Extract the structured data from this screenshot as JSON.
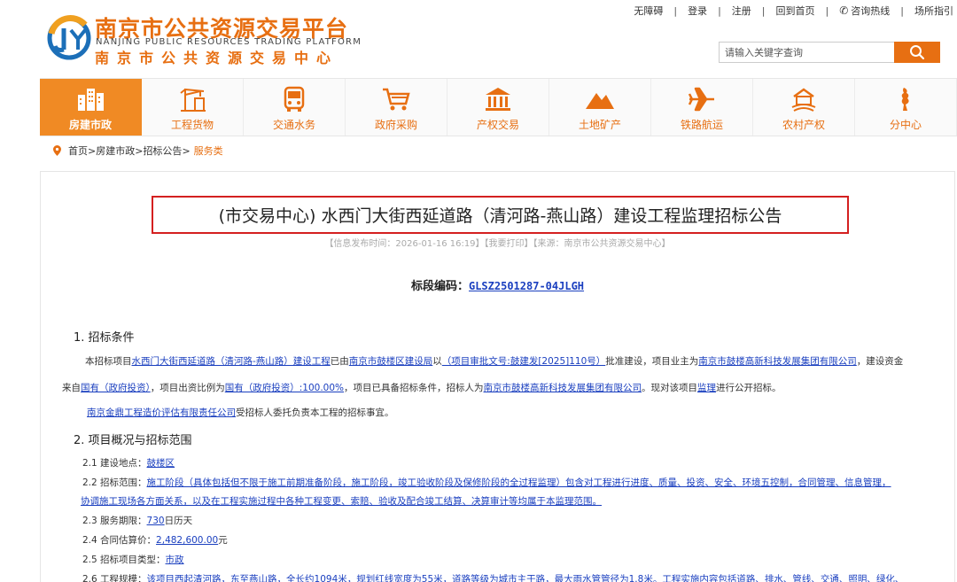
{
  "header": {
    "brand_cn": "南京市公共资源交易平台",
    "brand_en": "NANJING PUBLIC RESOURCES TRADING PLATFORM",
    "brand_center": "南京市公共资源交易中心",
    "links": [
      "无障碍",
      "登录",
      "注册",
      "回到首页",
      "咨询热线",
      "场所指引"
    ],
    "search_placeholder": "请输入关键字查询",
    "accent": "#e76f12"
  },
  "nav": {
    "items": [
      {
        "label": "房建市政",
        "icon": "building-icon",
        "active": true
      },
      {
        "label": "工程货物",
        "icon": "crane-icon"
      },
      {
        "label": "交通水务",
        "icon": "bus-icon"
      },
      {
        "label": "政府采购",
        "icon": "cart-icon"
      },
      {
        "label": "产权交易",
        "icon": "bank-icon"
      },
      {
        "label": "土地矿产",
        "icon": "mountain-icon"
      },
      {
        "label": "铁路航运",
        "icon": "airplane-icon"
      },
      {
        "label": "农村产权",
        "icon": "farm-icon"
      },
      {
        "label": "分中心",
        "icon": "branch-icon"
      }
    ]
  },
  "breadcrumb": {
    "home": "首页",
    "l1": "房建市政",
    "l2": "招标公告",
    "current": "服务类",
    "sep": ">"
  },
  "article": {
    "title": "(市交易中心) 水西门大街西延道路（清河路-燕山路）建设工程监理招标公告",
    "meta": "【信息发布时间：2026-01-16 16:19】【我要打印】【来源：南京市公共资源交易中心】",
    "bid_label": "标段编码：",
    "bid_code": "GLSZ2501287-04JLGH",
    "s1_title": "1.  招标条件",
    "p1": {
      "t1": "本招标项目",
      "l1": "水西门大街西延道路（清河路-燕山路）建设工程",
      "t2": "已由",
      "l2": "南京市鼓楼区建设局",
      "t3": "以",
      "l3": "（项目审批文号:鼓建发[2025]110号）",
      "t4": "批准建设，项目业主为",
      "l4": "南京市鼓楼高新科技发展集团有限公司",
      "t5": "，建设资金"
    },
    "p2": {
      "t1": "来自",
      "l1": "国有（政府投资）",
      "t2": "，项目出资比例为",
      "l2": "国有（政府投资）:100.00%",
      "t3": "，项目已具备招标条件，招标人为",
      "l3": "南京市鼓楼高新科技发展集团有限公司",
      "t4": "。现对该项目",
      "l4": "监理",
      "t5": "进行公开招标。"
    },
    "p3": {
      "l1": "南京金鼎工程造价评估有限责任公司",
      "t1": "受招标人委托负责本工程的招标事宜。"
    },
    "s2_title": "2.  项目概况与招标范围",
    "i21": {
      "label": "2.1 建设地点：",
      "value": "鼓楼区"
    },
    "i22": {
      "label": "2.2 招标范围：",
      "line1": "施工阶段（具体包括但不限于施工前期准备阶段，施工阶段，竣工验收阶段及保修阶段的全过程监理）包含对工程进行进度、质量、投资、安全、环境五控制，合同管理、信息管理，",
      "line2": "协调施工现场各方面关系，以及在工程实施过程中各种工程变更、索赔、验收及配合竣工结算、决算审计等均属于本监理范围。"
    },
    "i23": {
      "label": "2.3 服务期限：",
      "value": "730",
      "unit": "日历天"
    },
    "i24": {
      "label": "2.4 合同估算价：",
      "value": "2,482,600.00",
      "unit": "元"
    },
    "i25": {
      "label": "2.5 招标项目类型：",
      "value": "市政"
    },
    "i26": {
      "label": "2.6 工程规模：",
      "value": "该项目西起清河路，东至燕山路，全长约1094米，规划红线宽度为55米，道路等级为城市主干路，最大雨水管管径为1.8米。工程实施内容包括道路、排水、管线、交通、照明、绿化、"
    }
  }
}
